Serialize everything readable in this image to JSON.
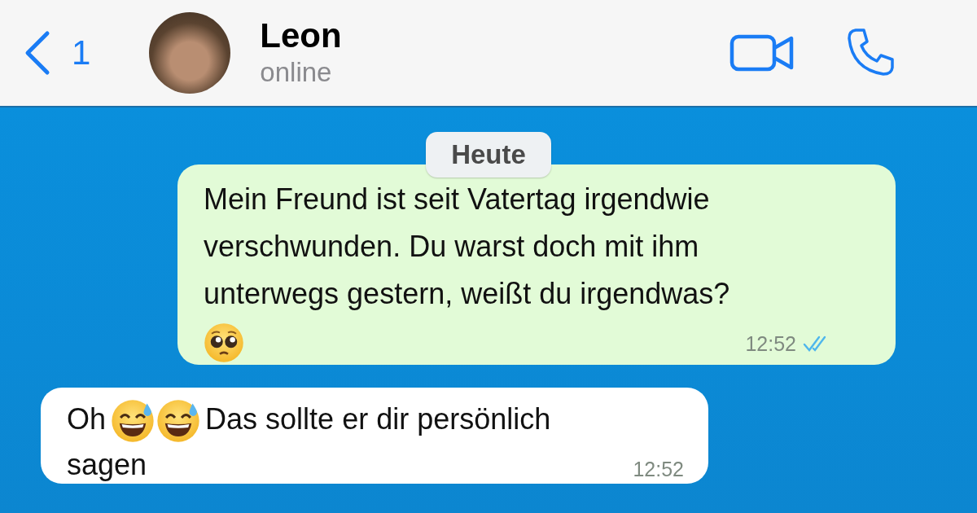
{
  "header": {
    "back_count": "1",
    "contact_name": "Leon",
    "status": "online"
  },
  "date_label": "Heute",
  "messages": [
    {
      "kind": "outgoing",
      "read": true,
      "time": "12:52",
      "parts": [
        {
          "kind": "text",
          "text": "Mein Freund ist seit Vatertag irgendwie verschwunden. Du warst doch mit ihm unterwegs gestern, weißt du irgendwas?"
        },
        {
          "kind": "break"
        },
        {
          "kind": "pleading"
        }
      ]
    },
    {
      "kind": "incoming",
      "time": "12:52",
      "parts": [
        {
          "kind": "text",
          "text": "Oh"
        },
        {
          "kind": "sweatsmile"
        },
        {
          "kind": "sweatsmile"
        },
        {
          "kind": "text",
          "text": "Das sollte er dir persönlich"
        },
        {
          "kind": "break"
        },
        {
          "kind": "text",
          "text": "sagen"
        }
      ]
    }
  ]
}
